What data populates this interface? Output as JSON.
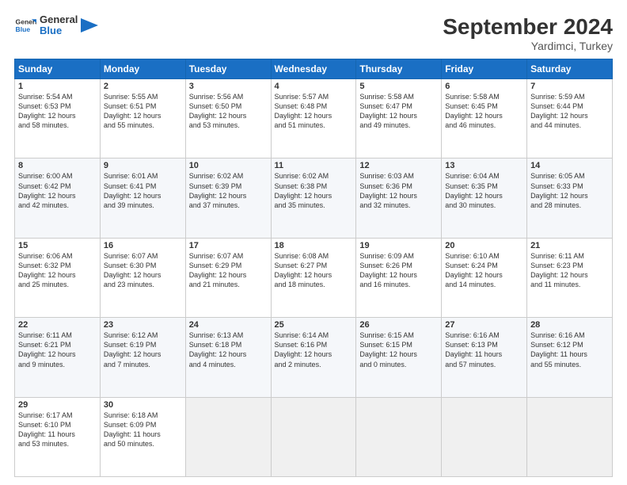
{
  "logo": {
    "text_general": "General",
    "text_blue": "Blue"
  },
  "header": {
    "month": "September 2024",
    "location": "Yardimci, Turkey"
  },
  "weekdays": [
    "Sunday",
    "Monday",
    "Tuesday",
    "Wednesday",
    "Thursday",
    "Friday",
    "Saturday"
  ],
  "weeks": [
    [
      {
        "day": "1",
        "info": "Sunrise: 5:54 AM\nSunset: 6:53 PM\nDaylight: 12 hours\nand 58 minutes."
      },
      {
        "day": "2",
        "info": "Sunrise: 5:55 AM\nSunset: 6:51 PM\nDaylight: 12 hours\nand 55 minutes."
      },
      {
        "day": "3",
        "info": "Sunrise: 5:56 AM\nSunset: 6:50 PM\nDaylight: 12 hours\nand 53 minutes."
      },
      {
        "day": "4",
        "info": "Sunrise: 5:57 AM\nSunset: 6:48 PM\nDaylight: 12 hours\nand 51 minutes."
      },
      {
        "day": "5",
        "info": "Sunrise: 5:58 AM\nSunset: 6:47 PM\nDaylight: 12 hours\nand 49 minutes."
      },
      {
        "day": "6",
        "info": "Sunrise: 5:58 AM\nSunset: 6:45 PM\nDaylight: 12 hours\nand 46 minutes."
      },
      {
        "day": "7",
        "info": "Sunrise: 5:59 AM\nSunset: 6:44 PM\nDaylight: 12 hours\nand 44 minutes."
      }
    ],
    [
      {
        "day": "8",
        "info": "Sunrise: 6:00 AM\nSunset: 6:42 PM\nDaylight: 12 hours\nand 42 minutes."
      },
      {
        "day": "9",
        "info": "Sunrise: 6:01 AM\nSunset: 6:41 PM\nDaylight: 12 hours\nand 39 minutes."
      },
      {
        "day": "10",
        "info": "Sunrise: 6:02 AM\nSunset: 6:39 PM\nDaylight: 12 hours\nand 37 minutes."
      },
      {
        "day": "11",
        "info": "Sunrise: 6:02 AM\nSunset: 6:38 PM\nDaylight: 12 hours\nand 35 minutes."
      },
      {
        "day": "12",
        "info": "Sunrise: 6:03 AM\nSunset: 6:36 PM\nDaylight: 12 hours\nand 32 minutes."
      },
      {
        "day": "13",
        "info": "Sunrise: 6:04 AM\nSunset: 6:35 PM\nDaylight: 12 hours\nand 30 minutes."
      },
      {
        "day": "14",
        "info": "Sunrise: 6:05 AM\nSunset: 6:33 PM\nDaylight: 12 hours\nand 28 minutes."
      }
    ],
    [
      {
        "day": "15",
        "info": "Sunrise: 6:06 AM\nSunset: 6:32 PM\nDaylight: 12 hours\nand 25 minutes."
      },
      {
        "day": "16",
        "info": "Sunrise: 6:07 AM\nSunset: 6:30 PM\nDaylight: 12 hours\nand 23 minutes."
      },
      {
        "day": "17",
        "info": "Sunrise: 6:07 AM\nSunset: 6:29 PM\nDaylight: 12 hours\nand 21 minutes."
      },
      {
        "day": "18",
        "info": "Sunrise: 6:08 AM\nSunset: 6:27 PM\nDaylight: 12 hours\nand 18 minutes."
      },
      {
        "day": "19",
        "info": "Sunrise: 6:09 AM\nSunset: 6:26 PM\nDaylight: 12 hours\nand 16 minutes."
      },
      {
        "day": "20",
        "info": "Sunrise: 6:10 AM\nSunset: 6:24 PM\nDaylight: 12 hours\nand 14 minutes."
      },
      {
        "day": "21",
        "info": "Sunrise: 6:11 AM\nSunset: 6:23 PM\nDaylight: 12 hours\nand 11 minutes."
      }
    ],
    [
      {
        "day": "22",
        "info": "Sunrise: 6:11 AM\nSunset: 6:21 PM\nDaylight: 12 hours\nand 9 minutes."
      },
      {
        "day": "23",
        "info": "Sunrise: 6:12 AM\nSunset: 6:19 PM\nDaylight: 12 hours\nand 7 minutes."
      },
      {
        "day": "24",
        "info": "Sunrise: 6:13 AM\nSunset: 6:18 PM\nDaylight: 12 hours\nand 4 minutes."
      },
      {
        "day": "25",
        "info": "Sunrise: 6:14 AM\nSunset: 6:16 PM\nDaylight: 12 hours\nand 2 minutes."
      },
      {
        "day": "26",
        "info": "Sunrise: 6:15 AM\nSunset: 6:15 PM\nDaylight: 12 hours\nand 0 minutes."
      },
      {
        "day": "27",
        "info": "Sunrise: 6:16 AM\nSunset: 6:13 PM\nDaylight: 11 hours\nand 57 minutes."
      },
      {
        "day": "28",
        "info": "Sunrise: 6:16 AM\nSunset: 6:12 PM\nDaylight: 11 hours\nand 55 minutes."
      }
    ],
    [
      {
        "day": "29",
        "info": "Sunrise: 6:17 AM\nSunset: 6:10 PM\nDaylight: 11 hours\nand 53 minutes."
      },
      {
        "day": "30",
        "info": "Sunrise: 6:18 AM\nSunset: 6:09 PM\nDaylight: 11 hours\nand 50 minutes."
      },
      {
        "day": "",
        "info": ""
      },
      {
        "day": "",
        "info": ""
      },
      {
        "day": "",
        "info": ""
      },
      {
        "day": "",
        "info": ""
      },
      {
        "day": "",
        "info": ""
      }
    ]
  ]
}
